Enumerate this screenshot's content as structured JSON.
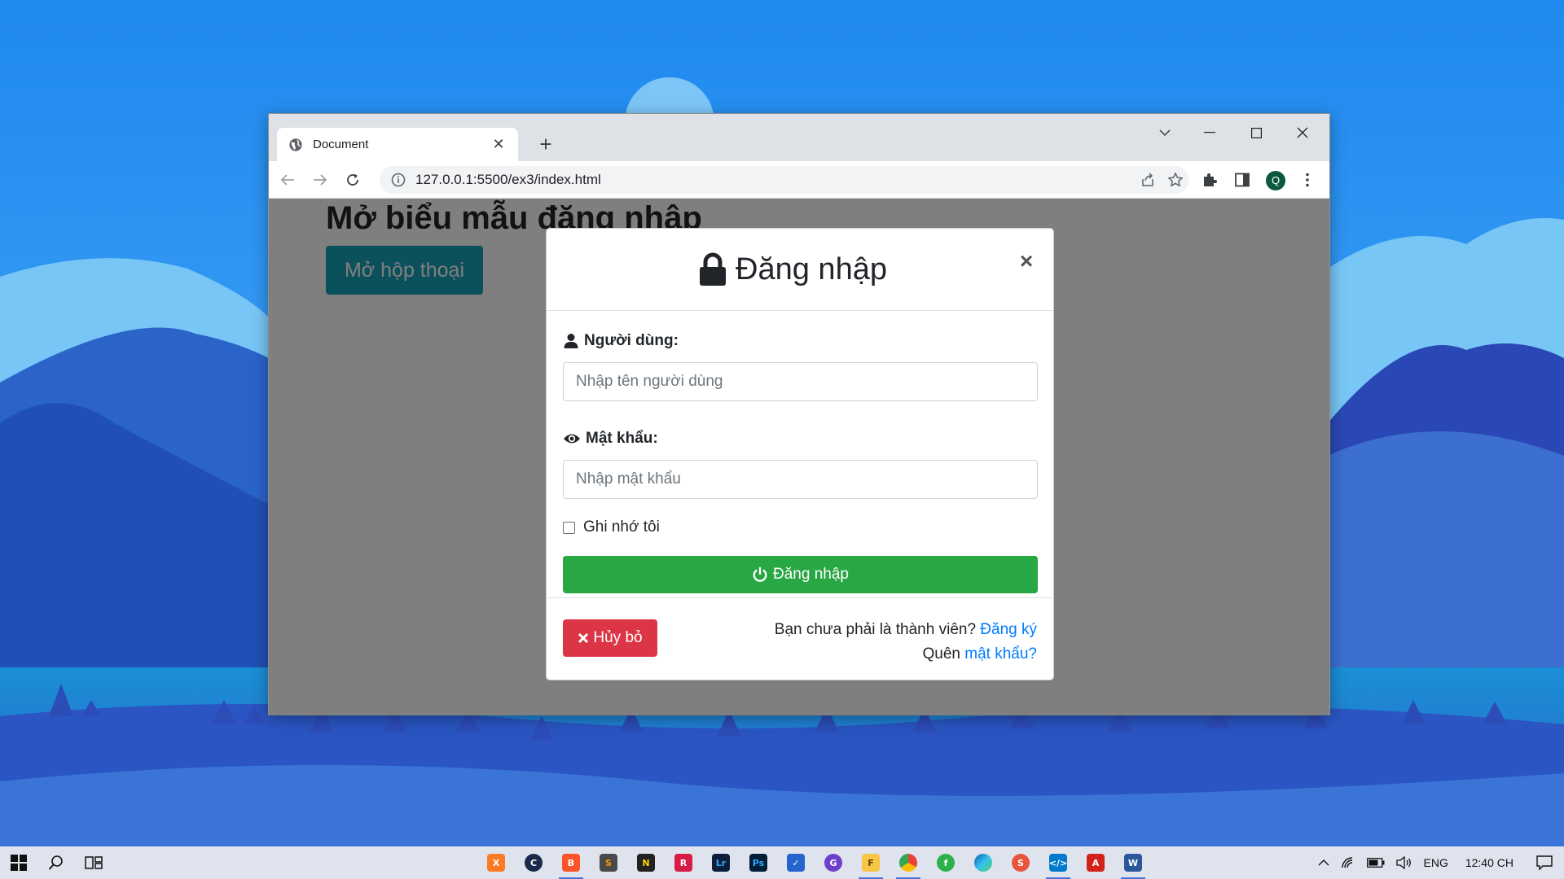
{
  "browser": {
    "tab_title": "Document",
    "url": "127.0.0.1:5500/ex3/index.html",
    "profile_initial": "Q"
  },
  "page": {
    "heading": "Mở biểu mẫu đăng nhập",
    "open_button": "Mở hộp thoại"
  },
  "modal": {
    "title": "Đăng nhập",
    "close": "×",
    "username_label": "Người dùng:",
    "username_placeholder": "Nhập tên người dùng",
    "password_label": "Mật khẩu:",
    "password_placeholder": "Nhập mật khẩu",
    "remember_label": "Ghi nhớ tôi",
    "submit_label": "Đăng nhập",
    "cancel_label": "Hủy bỏ",
    "not_member_text": "Bạn chưa phải là thành viên?",
    "register_link": "Đăng ký",
    "forgot_text": "Quên",
    "forgot_link": "mật khẩu?"
  },
  "taskbar": {
    "language": "ENG",
    "clock": "12:40 CH",
    "apps": [
      "xampp",
      "c-app",
      "brave",
      "sublime",
      "notes",
      "recorder",
      "lightroom-classic",
      "photoshop",
      "todo",
      "github-desktop",
      "file-explorer",
      "chrome",
      "feedly",
      "edge",
      "s-app",
      "vscode",
      "acrobat",
      "word"
    ]
  },
  "colors": {
    "primary_link": "#007bff",
    "success": "#28a745",
    "danger": "#dc3545",
    "info": "#17a2b8"
  }
}
